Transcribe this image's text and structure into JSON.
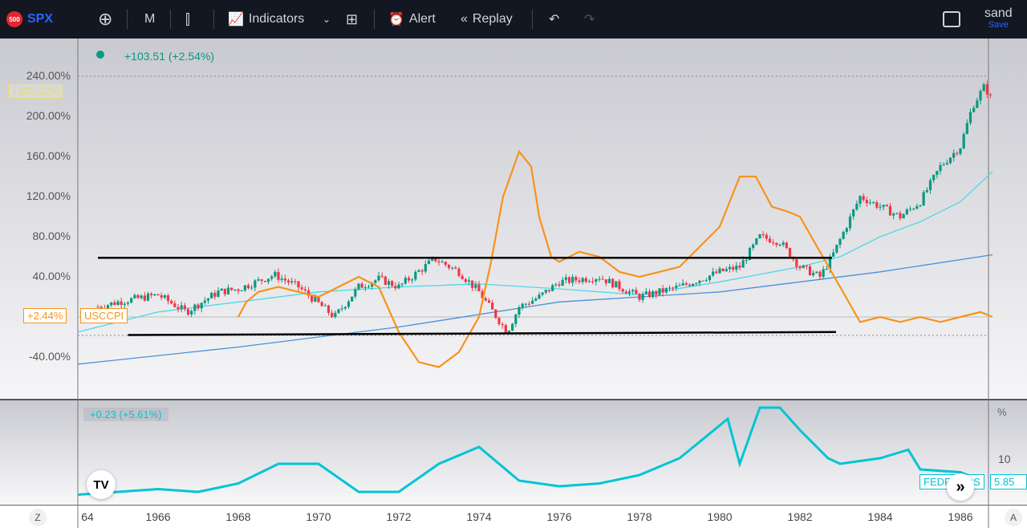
{
  "toolbar": {
    "logo": "500",
    "symbol": "SPX",
    "interval": "M",
    "indicators": "Indicators",
    "alert": "Alert",
    "replay": "Replay",
    "user": "sand",
    "save": "Save"
  },
  "legend": {
    "main_change": "+103.51 (+2.54%)",
    "lower_change": "+0.23 (+5.61%)"
  },
  "badges": {
    "spx_pct": "+225.22%",
    "cpi_pct": "+2.44%",
    "cpi_name": "USCCPI",
    "fed_name": "FEDFUNDS",
    "fed_value": "5.85",
    "lower_unit": "%",
    "lower_tick": "10"
  },
  "axis_buttons": {
    "left": "Z",
    "right": "A"
  },
  "colors": {
    "up": "#089981",
    "down": "#f23645",
    "cpi": "#f7931a",
    "ma_fast": "#4dd8e6",
    "ma_slow": "#4a90d9",
    "fed": "#00c4d4"
  },
  "chart_data": {
    "type": "line",
    "xlabel": "",
    "ylabel": "%",
    "x_ticks": [
      "64",
      "1966",
      "1968",
      "1970",
      "1972",
      "1974",
      "1976",
      "1978",
      "1980",
      "1982",
      "1984",
      "1986"
    ],
    "y_ticks": [
      "240.00%",
      "200.00%",
      "160.00%",
      "120.00%",
      "80.00%",
      "40.00%",
      "-40.00%"
    ],
    "ylim": [
      -80,
      270
    ],
    "series": [
      {
        "name": "SPX",
        "kind": "candles",
        "points": [
          [
            1964.5,
            10
          ],
          [
            1965,
            15
          ],
          [
            1966,
            22
          ],
          [
            1966.7,
            5
          ],
          [
            1967.5,
            25
          ],
          [
            1968,
            28
          ],
          [
            1968.9,
            42
          ],
          [
            1969.5,
            30
          ],
          [
            1970.4,
            0
          ],
          [
            1971,
            30
          ],
          [
            1971.5,
            38
          ],
          [
            1972,
            30
          ],
          [
            1972.9,
            58
          ],
          [
            1973.5,
            45
          ],
          [
            1974,
            25
          ],
          [
            1974.7,
            -15
          ],
          [
            1975,
            10
          ],
          [
            1975.5,
            20
          ],
          [
            1976,
            35
          ],
          [
            1977,
            40
          ],
          [
            1978,
            20
          ],
          [
            1979,
            30
          ],
          [
            1980,
            45
          ],
          [
            1980.5,
            50
          ],
          [
            1981,
            80
          ],
          [
            1981.5,
            75
          ],
          [
            1982,
            50
          ],
          [
            1982.5,
            40
          ],
          [
            1982.8,
            60
          ],
          [
            1983.5,
            120
          ],
          [
            1984,
            110
          ],
          [
            1984.5,
            100
          ],
          [
            1985,
            115
          ],
          [
            1985.5,
            150
          ],
          [
            1986,
            170
          ],
          [
            1986.3,
            210
          ],
          [
            1986.6,
            230
          ],
          [
            1986.8,
            215
          ]
        ]
      },
      {
        "name": "USCCPI",
        "points": [
          [
            1968,
            0
          ],
          [
            1968.2,
            15
          ],
          [
            1968.5,
            25
          ],
          [
            1969,
            30
          ],
          [
            1969.5,
            25
          ],
          [
            1970,
            20
          ],
          [
            1970.5,
            30
          ],
          [
            1971,
            40
          ],
          [
            1971.5,
            30
          ],
          [
            1972,
            -15
          ],
          [
            1972.5,
            -45
          ],
          [
            1973,
            -50
          ],
          [
            1973.5,
            -35
          ],
          [
            1974,
            0
          ],
          [
            1974.3,
            55
          ],
          [
            1974.6,
            120
          ],
          [
            1975,
            165
          ],
          [
            1975.3,
            150
          ],
          [
            1975.5,
            100
          ],
          [
            1975.8,
            60
          ],
          [
            1976,
            55
          ],
          [
            1976.5,
            65
          ],
          [
            1977,
            60
          ],
          [
            1977.5,
            45
          ],
          [
            1978,
            40
          ],
          [
            1978.5,
            45
          ],
          [
            1979,
            50
          ],
          [
            1979.5,
            70
          ],
          [
            1980,
            90
          ],
          [
            1980.5,
            140
          ],
          [
            1980.9,
            140
          ],
          [
            1981.3,
            110
          ],
          [
            1981.7,
            105
          ],
          [
            1982,
            100
          ],
          [
            1982.5,
            65
          ],
          [
            1983,
            30
          ],
          [
            1983.5,
            -5
          ],
          [
            1984,
            0
          ],
          [
            1984.5,
            -5
          ],
          [
            1985,
            0
          ],
          [
            1985.5,
            -5
          ],
          [
            1986,
            0
          ],
          [
            1986.5,
            5
          ],
          [
            1986.8,
            0
          ]
        ]
      },
      {
        "name": "MA fast",
        "points": [
          [
            1964,
            -15
          ],
          [
            1966,
            5
          ],
          [
            1968,
            15
          ],
          [
            1970,
            25
          ],
          [
            1972,
            30
          ],
          [
            1974,
            33
          ],
          [
            1976,
            28
          ],
          [
            1978,
            22
          ],
          [
            1980,
            35
          ],
          [
            1982,
            50
          ],
          [
            1983,
            60
          ],
          [
            1984,
            80
          ],
          [
            1985,
            95
          ],
          [
            1986,
            115
          ],
          [
            1986.8,
            145
          ]
        ]
      },
      {
        "name": "MA slow",
        "points": [
          [
            1964,
            -47
          ],
          [
            1968,
            -30
          ],
          [
            1972,
            -10
          ],
          [
            1976,
            15
          ],
          [
            1980,
            25
          ],
          [
            1984,
            45
          ],
          [
            1986.8,
            62
          ]
        ]
      },
      {
        "name": "Upper trendline",
        "points": [
          [
            1964.5,
            59
          ],
          [
            1982.8,
            59
          ]
        ]
      },
      {
        "name": "Lower trendline",
        "points": [
          [
            1965.25,
            -18
          ],
          [
            1982.9,
            -15
          ]
        ]
      },
      {
        "name": "FEDFUNDS",
        "pane": "lower",
        "points": [
          [
            1964,
            3.5
          ],
          [
            1966,
            4.5
          ],
          [
            1967,
            4
          ],
          [
            1968,
            5.5
          ],
          [
            1969,
            9
          ],
          [
            1970,
            9
          ],
          [
            1971,
            4
          ],
          [
            1972,
            4
          ],
          [
            1973,
            9
          ],
          [
            1974,
            12
          ],
          [
            1975,
            6
          ],
          [
            1976,
            5
          ],
          [
            1977,
            5.5
          ],
          [
            1978,
            7
          ],
          [
            1979,
            10
          ],
          [
            1980.2,
            17
          ],
          [
            1980.5,
            9
          ],
          [
            1981,
            19
          ],
          [
            1981.5,
            19
          ],
          [
            1982,
            15
          ],
          [
            1982.7,
            10
          ],
          [
            1983,
            9
          ],
          [
            1984,
            10
          ],
          [
            1984.7,
            11.5
          ],
          [
            1985,
            8
          ],
          [
            1986,
            7.5
          ],
          [
            1986.5,
            6
          ]
        ]
      }
    ]
  }
}
